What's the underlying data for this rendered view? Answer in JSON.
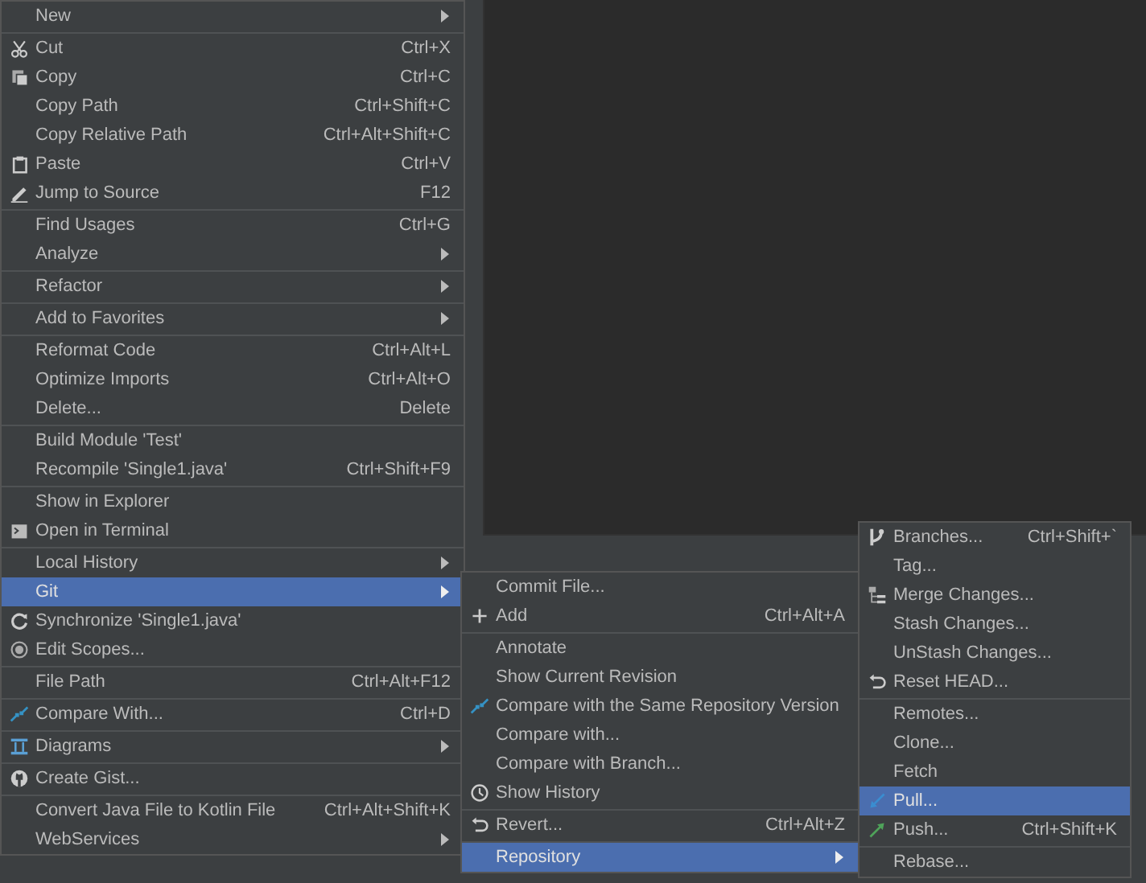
{
  "menus": [
    {
      "items": [
        {
          "kind": "item",
          "label": "New",
          "submenu": true,
          "selected": false
        },
        {
          "kind": "separator"
        },
        {
          "kind": "item",
          "label": "Cut",
          "shortcut": "Ctrl+X",
          "selected": false
        },
        {
          "kind": "item",
          "label": "Copy",
          "shortcut": "Ctrl+C",
          "selected": false
        },
        {
          "kind": "item",
          "label": "Copy Path",
          "shortcut": "Ctrl+Shift+C",
          "selected": false
        },
        {
          "kind": "item",
          "label": "Copy Relative Path",
          "shortcut": "Ctrl+Alt+Shift+C",
          "selected": false
        },
        {
          "kind": "item",
          "label": "Paste",
          "shortcut": "Ctrl+V",
          "selected": false
        },
        {
          "kind": "item",
          "label": "Jump to Source",
          "shortcut": "F12",
          "selected": false
        },
        {
          "kind": "separator"
        },
        {
          "kind": "item",
          "label": "Find Usages",
          "shortcut": "Ctrl+G",
          "selected": false
        },
        {
          "kind": "item",
          "label": "Analyze",
          "submenu": true,
          "selected": false
        },
        {
          "kind": "separator"
        },
        {
          "kind": "item",
          "label": "Refactor",
          "submenu": true,
          "selected": false
        },
        {
          "kind": "separator"
        },
        {
          "kind": "item",
          "label": "Add to Favorites",
          "submenu": true,
          "selected": false
        },
        {
          "kind": "separator"
        },
        {
          "kind": "item",
          "label": "Reformat Code",
          "shortcut": "Ctrl+Alt+L",
          "selected": false
        },
        {
          "kind": "item",
          "label": "Optimize Imports",
          "shortcut": "Ctrl+Alt+O",
          "selected": false
        },
        {
          "kind": "item",
          "label": "Delete...",
          "shortcut": "Delete",
          "selected": false
        },
        {
          "kind": "separator"
        },
        {
          "kind": "item",
          "label": "Build Module 'Test'",
          "selected": false
        },
        {
          "kind": "item",
          "label": "Recompile 'Single1.java'",
          "shortcut": "Ctrl+Shift+F9",
          "selected": false
        },
        {
          "kind": "separator"
        },
        {
          "kind": "item",
          "label": "Show in Explorer",
          "selected": false
        },
        {
          "kind": "item",
          "label": "Open in Terminal",
          "selected": false
        },
        {
          "kind": "separator"
        },
        {
          "kind": "item",
          "label": "Local History",
          "submenu": true,
          "selected": false
        },
        {
          "kind": "item",
          "label": "Git",
          "submenu": true,
          "selected": true
        },
        {
          "kind": "item",
          "label": "Synchronize 'Single1.java'",
          "selected": false
        },
        {
          "kind": "item",
          "label": "Edit Scopes...",
          "selected": false
        },
        {
          "kind": "separator"
        },
        {
          "kind": "item",
          "label": "File Path",
          "shortcut": "Ctrl+Alt+F12",
          "selected": false
        },
        {
          "kind": "separator"
        },
        {
          "kind": "item",
          "label": "Compare With...",
          "shortcut": "Ctrl+D",
          "selected": false
        },
        {
          "kind": "separator"
        },
        {
          "kind": "item",
          "label": "Diagrams",
          "submenu": true,
          "selected": false
        },
        {
          "kind": "separator"
        },
        {
          "kind": "item",
          "label": "Create Gist...",
          "selected": false
        },
        {
          "kind": "separator"
        },
        {
          "kind": "item",
          "label": "Convert Java File to Kotlin File",
          "shortcut": "Ctrl+Alt+Shift+K",
          "selected": false
        },
        {
          "kind": "item",
          "label": "WebServices",
          "submenu": true,
          "selected": false
        }
      ]
    },
    {
      "items": [
        {
          "kind": "item",
          "label": "Commit File...",
          "selected": false
        },
        {
          "kind": "item",
          "label": "Add",
          "shortcut": "Ctrl+Alt+A",
          "selected": false
        },
        {
          "kind": "separator"
        },
        {
          "kind": "item",
          "label": "Annotate",
          "selected": false
        },
        {
          "kind": "item",
          "label": "Show Current Revision",
          "selected": false
        },
        {
          "kind": "item",
          "label": "Compare with the Same Repository Version",
          "selected": false
        },
        {
          "kind": "item",
          "label": "Compare with...",
          "selected": false
        },
        {
          "kind": "item",
          "label": "Compare with Branch...",
          "selected": false
        },
        {
          "kind": "item",
          "label": "Show History",
          "selected": false
        },
        {
          "kind": "separator"
        },
        {
          "kind": "item",
          "label": "Revert...",
          "shortcut": "Ctrl+Alt+Z",
          "selected": false
        },
        {
          "kind": "separator"
        },
        {
          "kind": "item",
          "label": "Repository",
          "submenu": true,
          "selected": true
        }
      ]
    },
    {
      "items": [
        {
          "kind": "item",
          "label": "Branches...",
          "shortcut": "Ctrl+Shift+`",
          "selected": false
        },
        {
          "kind": "item",
          "label": "Tag...",
          "selected": false
        },
        {
          "kind": "item",
          "label": "Merge Changes...",
          "selected": false
        },
        {
          "kind": "item",
          "label": "Stash Changes...",
          "selected": false
        },
        {
          "kind": "item",
          "label": "UnStash Changes...",
          "selected": false
        },
        {
          "kind": "item",
          "label": "Reset HEAD...",
          "selected": false
        },
        {
          "kind": "separator"
        },
        {
          "kind": "item",
          "label": "Remotes...",
          "selected": false
        },
        {
          "kind": "item",
          "label": "Clone...",
          "selected": false
        },
        {
          "kind": "item",
          "label": "Fetch",
          "selected": false
        },
        {
          "kind": "item",
          "label": "Pull...",
          "selected": true
        },
        {
          "kind": "item",
          "label": "Push...",
          "shortcut": "Ctrl+Shift+K",
          "selected": false
        },
        {
          "kind": "separator"
        },
        {
          "kind": "item",
          "label": "Rebase...",
          "selected": false
        }
      ]
    }
  ]
}
